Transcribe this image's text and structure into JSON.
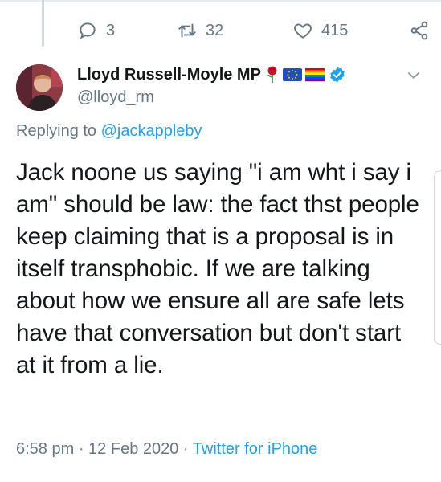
{
  "stats": {
    "replies": "3",
    "retweets": "32",
    "likes": "415"
  },
  "author": {
    "display_name": "Lloyd Russell-Moyle MP",
    "handle": "@lloyd_rm",
    "badges": [
      "rose-emoji",
      "eu-flag-emoji",
      "rainbow-flag-emoji",
      "verified-badge"
    ]
  },
  "reply": {
    "prefix": "Replying to",
    "mention": "@jackappleby"
  },
  "tweet": {
    "text": "Jack noone us saying \"i am wht i say i am\" should be law: the fact thst people keep claiming that is a proposal is in itself transphobic. If we are talking about how we ensure all are safe lets have that conversation but don't start at it from a lie."
  },
  "meta": {
    "time": "6:58 pm",
    "separator1": " · ",
    "date": "12 Feb 2020",
    "separator2": " · ",
    "source": "Twitter for iPhone"
  },
  "colors": {
    "accent": "#1da1f2",
    "muted": "#657786",
    "text": "#14171a"
  }
}
